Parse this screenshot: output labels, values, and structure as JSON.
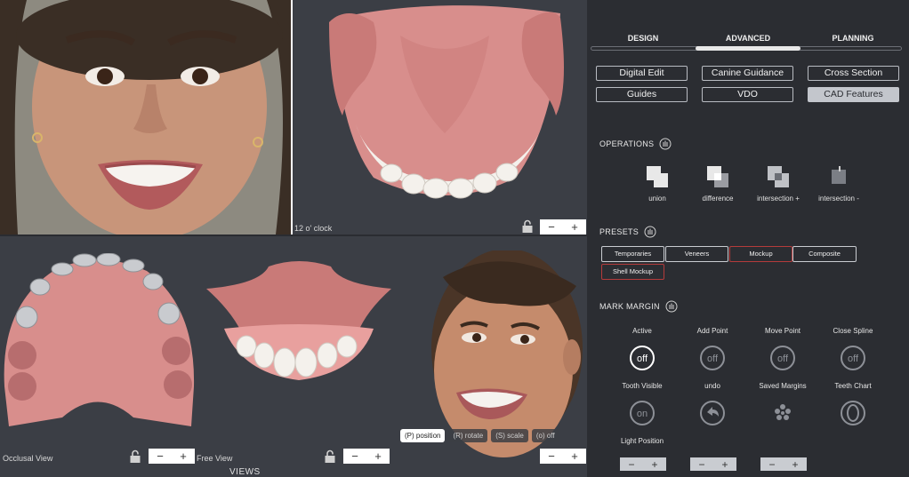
{
  "viewports": {
    "top_right_label": "12 o' clock",
    "bottom_left_label": "Occlusal View",
    "bottom_mid_label": "Free View",
    "views_title": "VIEWS",
    "stepper_minus": "−",
    "stepper_plus": "+",
    "modes": [
      {
        "label": "(P) position",
        "active": true
      },
      {
        "label": "(R) rotate",
        "active": false
      },
      {
        "label": "(S) scale",
        "active": false
      },
      {
        "label": "(o) off",
        "active": false
      }
    ]
  },
  "tabs": [
    {
      "label": "DESIGN"
    },
    {
      "label": "ADVANCED"
    },
    {
      "label": "PLANNING"
    }
  ],
  "advanced_buttons": [
    {
      "label": "Digital Edit",
      "active": false
    },
    {
      "label": "Canine Guidance",
      "active": false
    },
    {
      "label": "Cross Section",
      "active": false
    },
    {
      "label": "Guides",
      "active": false
    },
    {
      "label": "VDO",
      "active": false
    },
    {
      "label": "CAD Features",
      "active": true
    }
  ],
  "operations": {
    "title": "OPERATIONS",
    "items": [
      {
        "label": "union",
        "icon": "union-icon"
      },
      {
        "label": "difference",
        "icon": "difference-icon"
      },
      {
        "label": "intersection +",
        "icon": "intersection-plus-icon"
      },
      {
        "label": "intersection -",
        "icon": "intersection-minus-icon"
      }
    ]
  },
  "presets": {
    "title": "PRESETS",
    "items": [
      {
        "label": "Temporaries",
        "red": false
      },
      {
        "label": "Veneers",
        "red": false
      },
      {
        "label": "Mockup",
        "red": true
      },
      {
        "label": "Composite",
        "red": false
      },
      {
        "label": "Shell Mockup",
        "red": true
      }
    ]
  },
  "mark_margin": {
    "title": "MARK MARGIN",
    "row1": [
      {
        "label": "Active",
        "state": "off"
      },
      {
        "label": "Add Point",
        "state": "off"
      },
      {
        "label": "Move Point",
        "state": "off"
      },
      {
        "label": "Close Spline",
        "state": "off"
      }
    ],
    "row2": [
      {
        "label": "Tooth Visible",
        "state": "on"
      },
      {
        "label": "undo",
        "icon": "undo-icon"
      },
      {
        "label": "Saved Margins",
        "icon": "dots-icon"
      },
      {
        "label": "Teeth Chart",
        "icon": "teeth-chart-icon"
      }
    ],
    "light_position_label": "Light Position"
  },
  "colors": {
    "panel_bg": "#2b2d32",
    "viewport_bg": "#3b3e45",
    "gum": "#d88e8c",
    "preset_red": "#b53b3b"
  }
}
